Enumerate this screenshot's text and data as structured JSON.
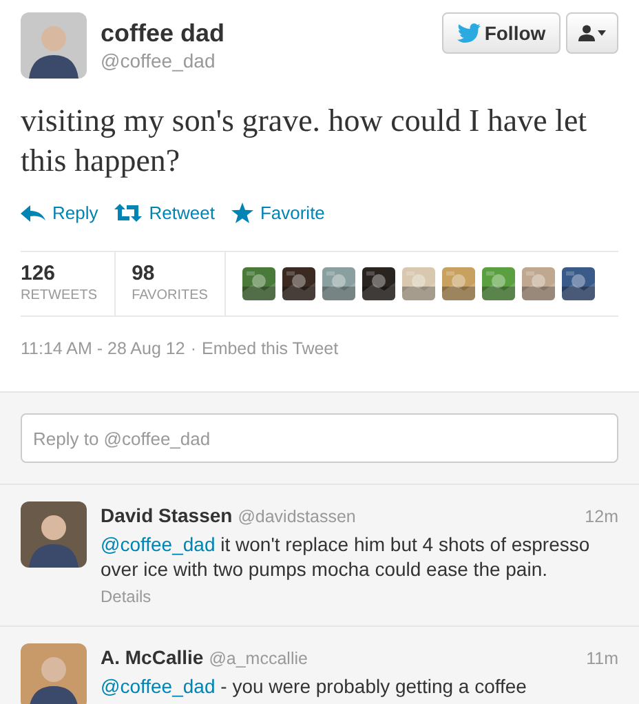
{
  "tweet": {
    "name": "coffee dad",
    "handle": "@coffee_dad",
    "follow_label": "Follow",
    "text": "visiting my son's grave. how could I have let this happen?",
    "actions": [
      {
        "kind": "reply",
        "label": "Reply"
      },
      {
        "kind": "retweet",
        "label": "Retweet"
      },
      {
        "kind": "favorite",
        "label": "Favorite"
      }
    ],
    "stats": [
      {
        "count": "126",
        "label": "RETWEETS"
      },
      {
        "count": "98",
        "label": "FAVORITES"
      }
    ],
    "timestamp": "11:14 AM - 28 Aug 12",
    "separator": "·",
    "embed_link": "Embed this Tweet"
  },
  "reply_box": {
    "placeholder": "Reply to @coffee_dad"
  },
  "replies": [
    {
      "name": "David Stassen",
      "handle": "@davidstassen",
      "time": "12m",
      "mention": "@coffee_dad",
      "text": " it won't replace him but 4 shots of espresso over ice with two pumps mocha could ease the pain.",
      "details": "Details"
    },
    {
      "name": "A. McCallie",
      "handle": "@a_mccallie",
      "time": "11m",
      "mention": "@coffee_dad",
      "text": " - you were probably getting a coffee"
    }
  ]
}
